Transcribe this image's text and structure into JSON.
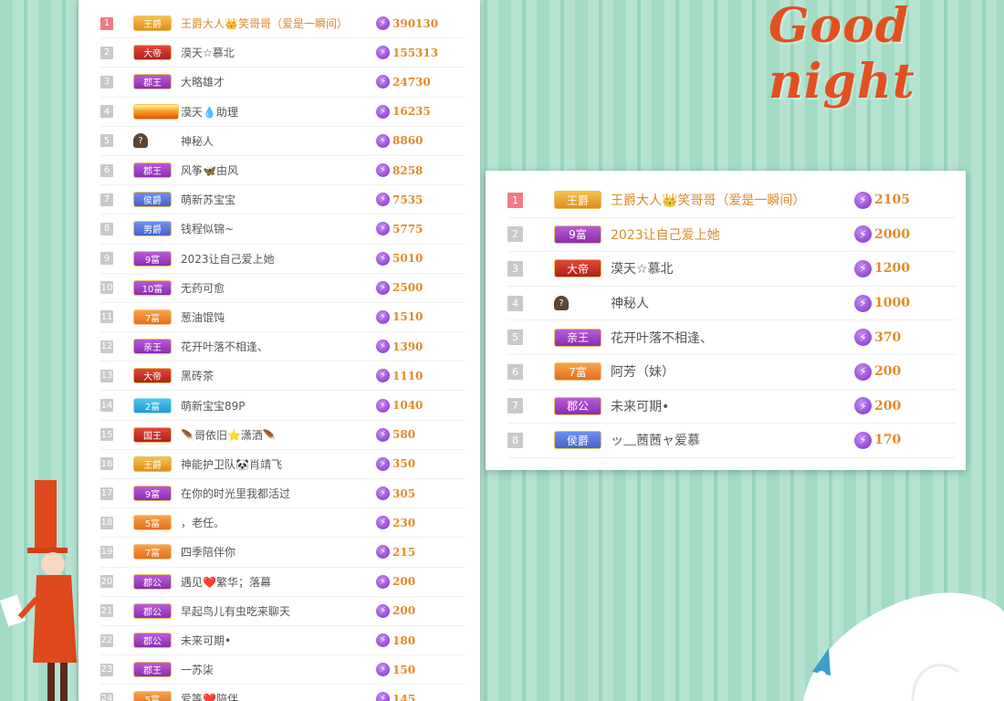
{
  "decor": {
    "title": "Good night"
  },
  "colors": {
    "background": "#a6dcc6",
    "accent": "#e38a2a",
    "bolt": "#8a3fd1"
  },
  "left_list": [
    {
      "rank": "1",
      "badge": "王爵",
      "badge_style": "gold",
      "name": "王爵大人👑笑哥哥（爱是一瞬间）",
      "score": "390130",
      "highlight": true,
      "top": true
    },
    {
      "rank": "2",
      "badge": "大帝",
      "badge_style": "red",
      "name": "漠天☆慕北",
      "score": "155313"
    },
    {
      "rank": "3",
      "badge": "郡王",
      "badge_style": "purple",
      "name": "大略雄才",
      "score": "24730"
    },
    {
      "rank": "4",
      "badge": "",
      "badge_style": "flame",
      "name": "漠天💧助理",
      "score": "16235"
    },
    {
      "rank": "5",
      "badge": "",
      "badge_style": "mystery",
      "name": "神秘人",
      "score": "8860"
    },
    {
      "rank": "6",
      "badge": "郡王",
      "badge_style": "purple",
      "name": "风筝🦋由风",
      "score": "8258"
    },
    {
      "rank": "7",
      "badge": "侯爵",
      "badge_style": "blue",
      "name": "萌新苏宝宝",
      "score": "7535"
    },
    {
      "rank": "8",
      "badge": "男爵",
      "badge_style": "blue",
      "name": "钱程似锦~",
      "score": "5775"
    },
    {
      "rank": "9",
      "badge": "9富",
      "badge_style": "purple",
      "name": "2023让自己爱上她",
      "score": "5010"
    },
    {
      "rank": "10",
      "badge": "10富",
      "badge_style": "purple",
      "name": "无药可愈",
      "score": "2500"
    },
    {
      "rank": "11",
      "badge": "7富",
      "badge_style": "orange",
      "name": "葱油馄饨",
      "score": "1510"
    },
    {
      "rank": "12",
      "badge": "亲王",
      "badge_style": "purple",
      "name": "花开叶落不相逢、",
      "score": "1390"
    },
    {
      "rank": "13",
      "badge": "大帝",
      "badge_style": "red",
      "name": "黑砖茶",
      "score": "1110"
    },
    {
      "rank": "14",
      "badge": "2富",
      "badge_style": "cyan",
      "name": "萌新宝宝89P",
      "score": "1040"
    },
    {
      "rank": "15",
      "badge": "国王",
      "badge_style": "red",
      "name": "🪶哥依旧⭐潇洒🪶",
      "score": "580"
    },
    {
      "rank": "16",
      "badge": "王爵",
      "badge_style": "gold",
      "name": "神能护卫队🐼肖靖飞",
      "score": "350"
    },
    {
      "rank": "17",
      "badge": "9富",
      "badge_style": "purple",
      "name": "在你的时光里我都活过",
      "score": "305"
    },
    {
      "rank": "18",
      "badge": "5富",
      "badge_style": "orange",
      "name": "，老任。",
      "score": "230"
    },
    {
      "rank": "19",
      "badge": "7富",
      "badge_style": "orange",
      "name": "四季陪伴你",
      "score": "215"
    },
    {
      "rank": "20",
      "badge": "郡公",
      "badge_style": "purple",
      "name": "遇见❤️繁华；落幕",
      "score": "200"
    },
    {
      "rank": "21",
      "badge": "郡公",
      "badge_style": "purple",
      "name": "早起鸟儿有虫吃来聊天",
      "score": "200"
    },
    {
      "rank": "22",
      "badge": "郡公",
      "badge_style": "purple",
      "name": "未来可期•",
      "score": "180"
    },
    {
      "rank": "23",
      "badge": "郡王",
      "badge_style": "purple",
      "name": "一苏柒",
      "score": "150"
    },
    {
      "rank": "24",
      "badge": "5富",
      "badge_style": "orange",
      "name": "爱等❤️陪伴",
      "score": "145"
    }
  ],
  "right_list": [
    {
      "rank": "1",
      "badge": "王爵",
      "badge_style": "gold",
      "name": "王爵大人👑笑哥哥（爱是一瞬间）",
      "score": "2105",
      "highlight": true,
      "top": true
    },
    {
      "rank": "2",
      "badge": "9富",
      "badge_style": "purple",
      "name": "2023让自己爱上她",
      "score": "2000",
      "highlight": true
    },
    {
      "rank": "3",
      "badge": "大帝",
      "badge_style": "red",
      "name": "漠天☆慕北",
      "score": "1200"
    },
    {
      "rank": "4",
      "badge": "",
      "badge_style": "mystery",
      "name": "神秘人",
      "score": "1000"
    },
    {
      "rank": "5",
      "badge": "亲王",
      "badge_style": "purple",
      "name": "花开叶落不相逢、",
      "score": "370"
    },
    {
      "rank": "6",
      "badge": "7富",
      "badge_style": "orange",
      "name": "阿芳（妹）",
      "score": "200"
    },
    {
      "rank": "7",
      "badge": "郡公",
      "badge_style": "purple",
      "name": "未来可期•",
      "score": "200"
    },
    {
      "rank": "8",
      "badge": "侯爵",
      "badge_style": "blue",
      "name": "ッ﹏莤莤ャ爱慕",
      "score": "170"
    }
  ]
}
